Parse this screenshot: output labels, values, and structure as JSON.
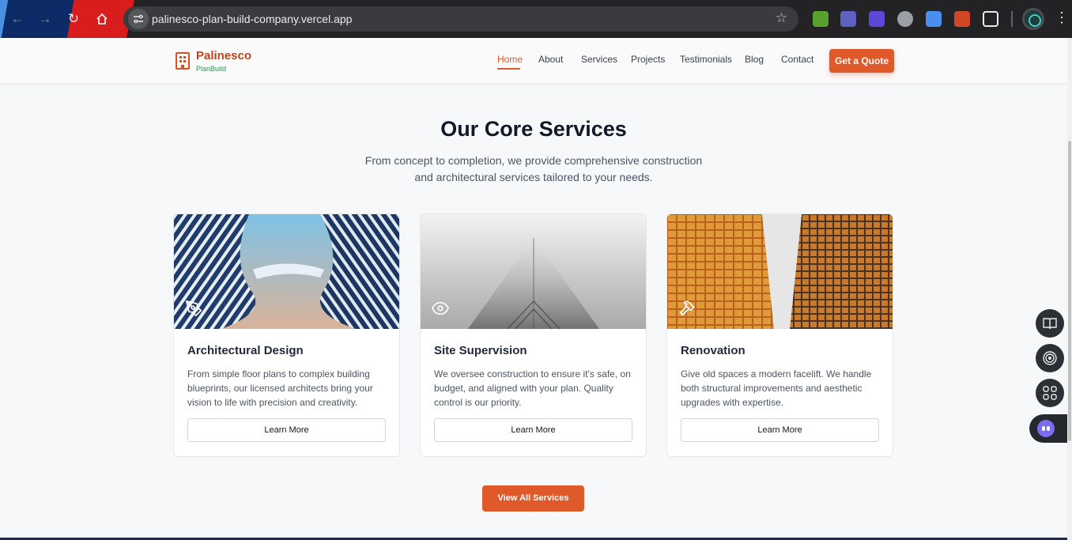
{
  "browser": {
    "url": "palinesco-plan-build-company.vercel.app",
    "icons": [
      "back-icon",
      "forward-icon",
      "reload-icon",
      "home-icon",
      "site-info-icon",
      "bookmark-star-icon",
      "extensions-icon",
      "menu-icon"
    ]
  },
  "header": {
    "brand_name": "Palinesco",
    "brand_sub": "PlanBuild",
    "nav": [
      {
        "label": "Home",
        "active": true
      },
      {
        "label": "About"
      },
      {
        "label": "Services"
      },
      {
        "label": "Projects"
      },
      {
        "label": "Testimonials"
      },
      {
        "label": "Blog"
      },
      {
        "label": "Contact"
      }
    ],
    "cta_label": "Get a Quote"
  },
  "services": {
    "title": "Our Core Services",
    "description": "From concept to completion, we provide comprehensive construction and architectural services tailored to your needs.",
    "cards": [
      {
        "title": "Architectural Design",
        "description": "From simple floor plans to complex building blueprints, our licensed architects bring your vision to life with precision and creativity.",
        "button": "Learn More",
        "icon": "pen-tool-icon"
      },
      {
        "title": "Site Supervision",
        "description": "We oversee construction to ensure it's safe, on budget, and aligned with your plan. Quality control is our priority.",
        "button": "Learn More",
        "icon": "eye-icon"
      },
      {
        "title": "Renovation",
        "description": "Give old spaces a modern facelift. We handle both structural improvements and aesthetic upgrades with expertise.",
        "button": "Learn More",
        "icon": "hammer-icon"
      }
    ],
    "view_all_label": "View All Services"
  },
  "colors": {
    "accent": "#e0592a",
    "brand_green": "#16a34a"
  }
}
